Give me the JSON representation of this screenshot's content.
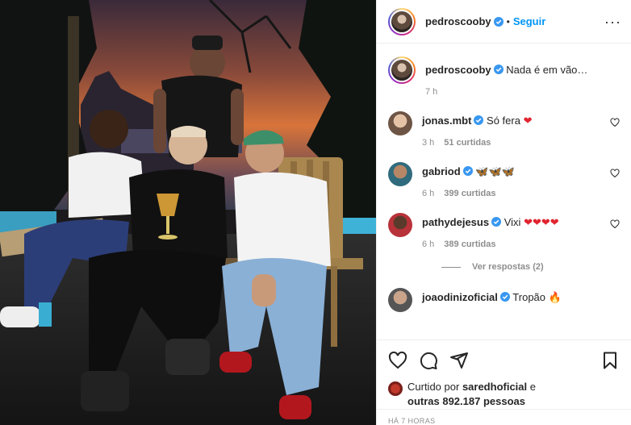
{
  "post": {
    "author": "pedroscooby",
    "follow_label": "Seguir",
    "more_icon": "more-options-icon",
    "caption": "Nada é em vão…",
    "caption_time": "7 h"
  },
  "comments": [
    {
      "user": "jonas.mbt",
      "text": "Só fera",
      "emoji": "heart",
      "emoji_count": 1,
      "time": "3 h",
      "likes": "51 curtidas"
    },
    {
      "user": "gabriod",
      "text": "",
      "emoji": "butterfly",
      "emoji_count": 3,
      "time": "6 h",
      "likes": "399 curtidas"
    },
    {
      "user": "pathydejesus",
      "text": "Vixi",
      "emoji": "heart",
      "emoji_count": 4,
      "time": "6 h",
      "likes": "389 curtidas",
      "replies_label": "Ver respostas (2)"
    },
    {
      "user": "joaodinizoficial",
      "text": "Tropão",
      "emoji": "fire",
      "emoji_count": 1
    }
  ],
  "likes": {
    "prefix": "Curtido por",
    "user": "saredhoficial",
    "connector": "e",
    "others": "outras 892.187 pessoas"
  },
  "timestamp": "HÁ 7 HORAS",
  "colors": {
    "accent_blue": "#0095f6",
    "verified_blue": "#3897f0",
    "heart_red": "#ed4956",
    "meta_gray": "#8e8e8e"
  }
}
